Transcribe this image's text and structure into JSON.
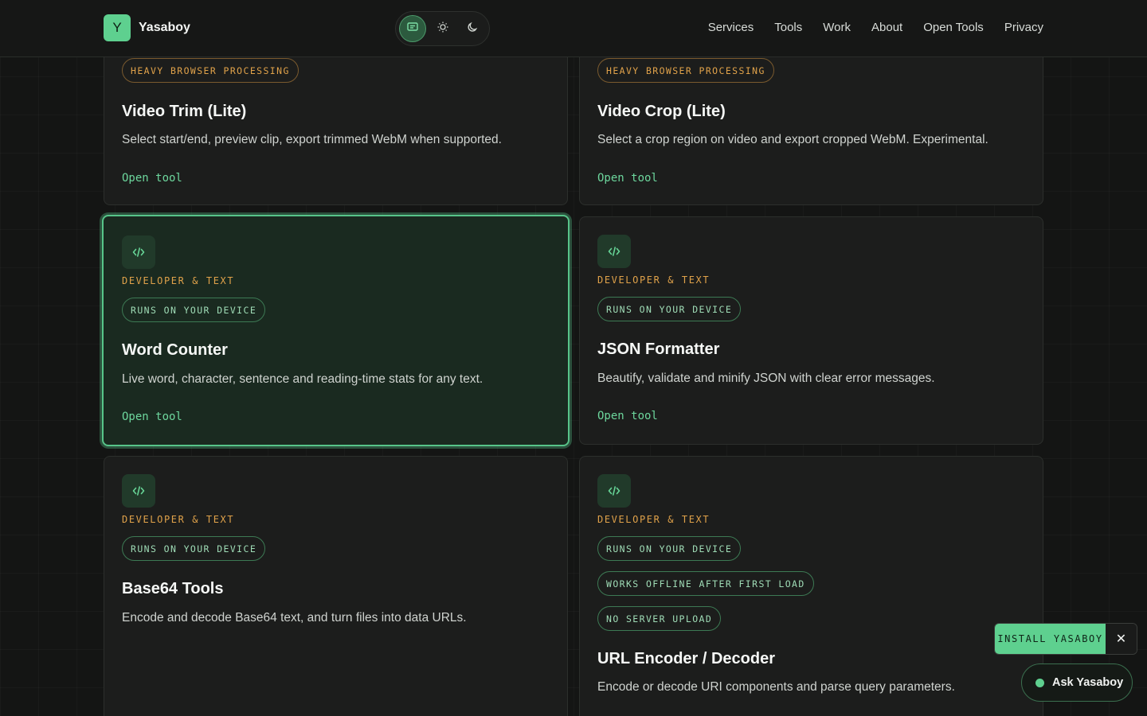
{
  "brand": {
    "mark": "Y",
    "name": "Yasaboy"
  },
  "theme": {
    "options": [
      "system-icon",
      "sun-icon",
      "moon-icon"
    ],
    "active": "system"
  },
  "nav": [
    "Services",
    "Tools",
    "Work",
    "About",
    "Open Tools",
    "Privacy"
  ],
  "cards": [
    {
      "category": "",
      "badges": [
        {
          "label": "HEAVY BROWSER PROCESSING",
          "tone": "warning"
        }
      ],
      "title": "Video Trim (Lite)",
      "description": "Select start/end, preview clip, export trimmed WebM when supported.",
      "link": "Open tool"
    },
    {
      "category": "",
      "badges": [
        {
          "label": "HEAVY BROWSER PROCESSING",
          "tone": "warning"
        }
      ],
      "title": "Video Crop (Lite)",
      "description": "Select a crop region on video and export cropped WebM. Experimental.",
      "link": "Open tool"
    },
    {
      "category": "DEVELOPER & TEXT",
      "icon": "code-icon",
      "badges": [
        {
          "label": "RUNS ON YOUR DEVICE",
          "tone": "success"
        }
      ],
      "title": "Word Counter",
      "description": "Live word, character, sentence and reading-time stats for any text.",
      "link": "Open tool",
      "selected": true
    },
    {
      "category": "DEVELOPER & TEXT",
      "icon": "code-icon",
      "badges": [
        {
          "label": "RUNS ON YOUR DEVICE",
          "tone": "success"
        }
      ],
      "title": "JSON Formatter",
      "description": "Beautify, validate and minify JSON with clear error messages.",
      "link": "Open tool"
    },
    {
      "category": "DEVELOPER & TEXT",
      "icon": "code-icon",
      "badges": [
        {
          "label": "RUNS ON YOUR DEVICE",
          "tone": "success"
        }
      ],
      "title": "Base64 Tools",
      "description": "Encode and decode Base64 text, and turn files into data URLs."
    },
    {
      "category": "DEVELOPER & TEXT",
      "icon": "code-icon",
      "badges": [
        {
          "label": "RUNS ON YOUR DEVICE",
          "tone": "success"
        },
        {
          "label": "WORKS OFFLINE AFTER FIRST LOAD",
          "tone": "success"
        },
        {
          "label": "NO SERVER UPLOAD",
          "tone": "success"
        }
      ],
      "title": "URL Encoder / Decoder",
      "description": "Encode or decode URI components and parse query parameters."
    }
  ],
  "install": {
    "label": "INSTALL YASABOY",
    "close": "✕"
  },
  "assistant": {
    "label": "Ask Yasaboy"
  },
  "colors": {
    "accent": "#5ed08f",
    "category": "#e0a24a",
    "background": "#141514"
  }
}
